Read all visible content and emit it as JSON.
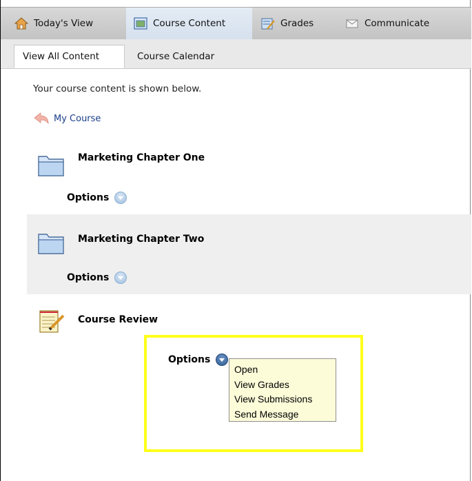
{
  "nav": {
    "items": [
      {
        "label": "Today's View",
        "icon": "home-icon"
      },
      {
        "label": "Course Content",
        "icon": "course-content-icon",
        "active": true
      },
      {
        "label": "Grades",
        "icon": "gradebook-icon"
      },
      {
        "label": "Communicate",
        "icon": "envelope-icon"
      }
    ]
  },
  "subtabs": {
    "items": [
      {
        "label": "View All Content",
        "active": true
      },
      {
        "label": "Course Calendar"
      }
    ]
  },
  "content": {
    "intro": "Your course content is shown below.",
    "breadcrumb": "My Course",
    "items": [
      {
        "title": "Marketing Chapter One",
        "options_label": "Options",
        "icon": "folder-icon"
      },
      {
        "title": "Marketing Chapter Two",
        "options_label": "Options",
        "icon": "folder-icon"
      },
      {
        "title": "Course Review",
        "options_label": "Options",
        "icon": "notepad-pencil-icon"
      }
    ]
  },
  "options_menu": {
    "items": [
      "Open",
      "View Grades",
      "View Submissions",
      "Send Message"
    ]
  },
  "colors": {
    "highlight": "#ffff1a",
    "menu_bg": "#fdfcd9",
    "link": "#1a3f8a"
  }
}
